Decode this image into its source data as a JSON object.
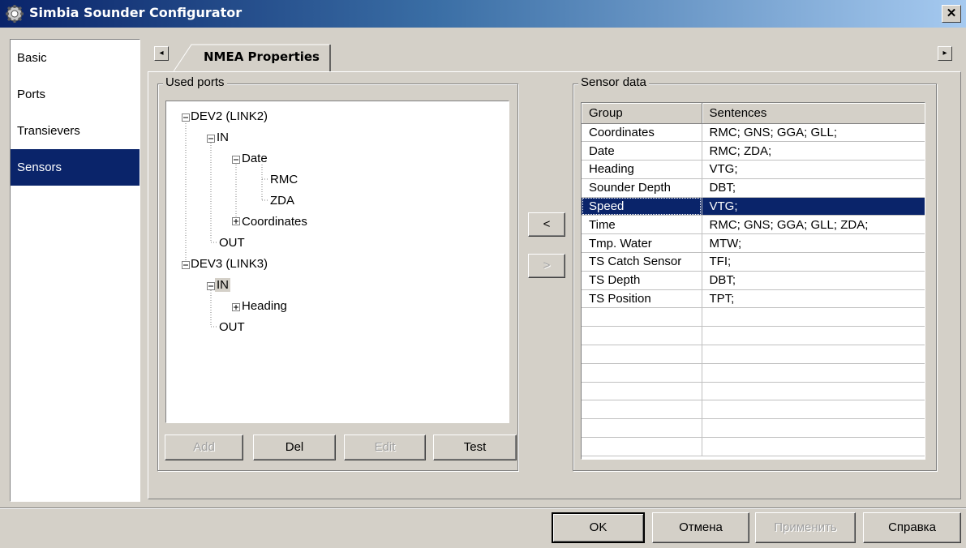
{
  "window": {
    "title": "Simbia Sounder Configurator",
    "close_label": "✕",
    "titlebar_color": "#0a246a"
  },
  "nav": {
    "items": [
      {
        "label": "Basic"
      },
      {
        "label": "Ports"
      },
      {
        "label": "Transievers"
      },
      {
        "label": "Sensors"
      }
    ],
    "selected": "Sensors"
  },
  "tabs": {
    "active_label": "NMEA Properties",
    "scroll_left": "◂",
    "scroll_right": "▸"
  },
  "used_ports": {
    "title": "Used ports",
    "tree": [
      {
        "label": "DEV2 (LINK2)"
      },
      {
        "label": "IN"
      },
      {
        "label": "Date"
      },
      {
        "label": "RMC"
      },
      {
        "label": "ZDA"
      },
      {
        "label": "Coordinates"
      },
      {
        "label": "OUT"
      },
      {
        "label": "DEV3 (LINK3)"
      },
      {
        "label": "IN"
      },
      {
        "label": "Heading"
      },
      {
        "label": "OUT"
      }
    ],
    "buttons": {
      "add": "Add",
      "del": "Del",
      "edit": "Edit",
      "test": "Test"
    }
  },
  "transfer": {
    "left": "<",
    "right": ">"
  },
  "sensor_data": {
    "title": "Sensor data",
    "columns": [
      "Group",
      "Sentences"
    ],
    "rows": [
      {
        "group": "Coordinates",
        "sentences": "RMC; GNS; GGA; GLL;"
      },
      {
        "group": "Date",
        "sentences": "RMC; ZDA;"
      },
      {
        "group": "Heading",
        "sentences": "VTG;"
      },
      {
        "group": "Sounder Depth",
        "sentences": "DBT;"
      },
      {
        "group": "Speed",
        "sentences": "VTG;"
      },
      {
        "group": "Time",
        "sentences": "RMC; GNS; GGA; GLL; ZDA;"
      },
      {
        "group": "Tmp. Water",
        "sentences": "MTW;"
      },
      {
        "group": "TS Catch Sensor",
        "sentences": "TFI;"
      },
      {
        "group": "TS Depth",
        "sentences": "DBT;"
      },
      {
        "group": "TS Position",
        "sentences": "TPT;"
      },
      {
        "group": "",
        "sentences": ""
      },
      {
        "group": "",
        "sentences": ""
      },
      {
        "group": "",
        "sentences": ""
      },
      {
        "group": "",
        "sentences": ""
      },
      {
        "group": "",
        "sentences": ""
      },
      {
        "group": "",
        "sentences": ""
      },
      {
        "group": "",
        "sentences": ""
      },
      {
        "group": "",
        "sentences": ""
      }
    ],
    "selected_group": "Speed",
    "selection_color": "#0a246a"
  },
  "footer": {
    "ok": "OK",
    "cancel": "Отмена",
    "apply": "Применить",
    "help": "Справка"
  }
}
